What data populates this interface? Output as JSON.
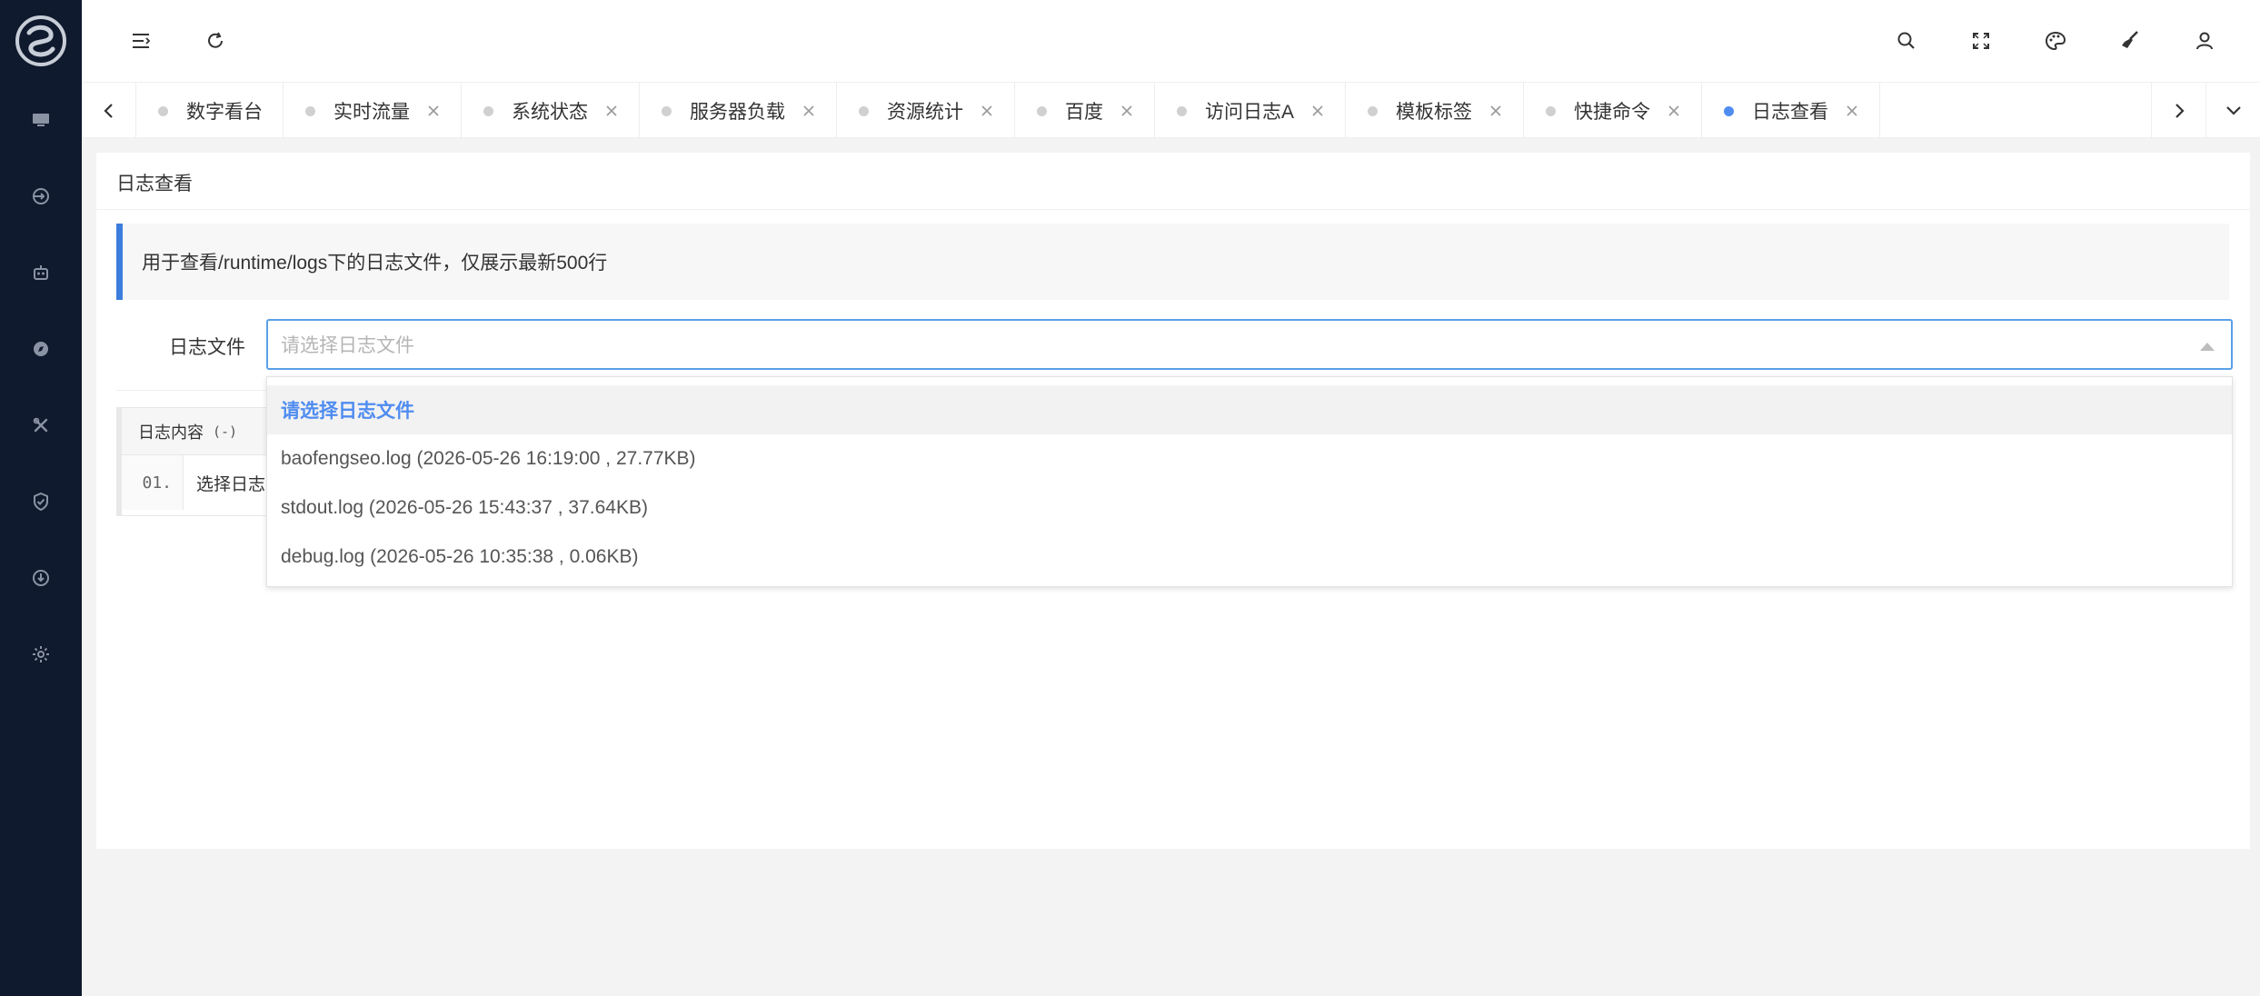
{
  "header": {
    "icons": [
      "menu-fold-icon",
      "refresh-icon",
      "search-icon",
      "fullscreen-icon",
      "theme-palette-icon",
      "clear-cache-brush-icon",
      "user-icon"
    ]
  },
  "sidebar": {
    "icons": [
      "monitor-icon",
      "traffic-icon",
      "robot-icon",
      "compass-icon",
      "tools-icon",
      "shield-icon",
      "download-icon",
      "settings-icon"
    ]
  },
  "tabs": [
    {
      "label": "数字看台",
      "closable": false,
      "active": false
    },
    {
      "label": "实时流量",
      "closable": true,
      "active": false
    },
    {
      "label": "系统状态",
      "closable": true,
      "active": false
    },
    {
      "label": "服务器负载",
      "closable": true,
      "active": false
    },
    {
      "label": "资源统计",
      "closable": true,
      "active": false
    },
    {
      "label": "百度",
      "closable": true,
      "active": false
    },
    {
      "label": "访问日志A",
      "closable": true,
      "active": false
    },
    {
      "label": "模板标签",
      "closable": true,
      "active": false
    },
    {
      "label": "快捷命令",
      "closable": true,
      "active": false
    },
    {
      "label": "日志查看",
      "closable": true,
      "active": true
    }
  ],
  "panel": {
    "title": "日志查看",
    "notice": "用于查看/runtime/logs下的日志文件，仅展示最新500行",
    "form_label": "日志文件",
    "select_placeholder": "请选择日志文件",
    "log_header": "日志内容",
    "log_meta": "(-)",
    "log_line_no": "01.",
    "log_line_text": "选择日志"
  },
  "dropdown": {
    "options": [
      {
        "label": "请选择日志文件",
        "selected": true
      },
      {
        "label": "baofengseo.log (2026-05-26 16:19:00 , 27.77KB)",
        "selected": false
      },
      {
        "label": "stdout.log (2026-05-26 15:43:37 , 37.64KB)",
        "selected": false
      },
      {
        "label": "debug.log (2026-05-26 10:35:38 , 0.06KB)",
        "selected": false
      }
    ]
  },
  "colors": {
    "sidebar_bg": "#0f1a2e",
    "accent": "#3b7ddd",
    "active_dot": "#4f8cf0"
  }
}
